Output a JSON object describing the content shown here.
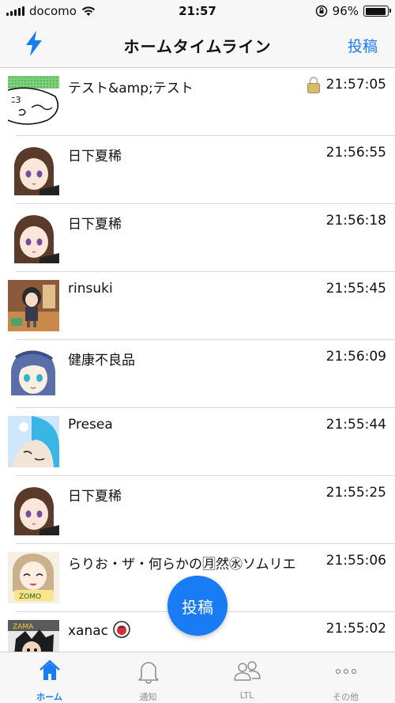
{
  "status_bar": {
    "carrier": "docomo",
    "time": "21:57",
    "battery": "96%",
    "battery_level": 0.96
  },
  "nav": {
    "title": "ホームタイムライン",
    "post_button": "投稿",
    "left_icon": "lightning-bolt-icon"
  },
  "timeline": [
    {
      "name": "テスト&amp;テスト",
      "time": "21:57:05",
      "locked": true,
      "avatar": "doodle-face"
    },
    {
      "name": "日下夏稀",
      "time": "21:56:55",
      "avatar": "anime-girl-brown-hair"
    },
    {
      "name": "日下夏稀",
      "time": "21:56:18",
      "avatar": "anime-girl-brown-hair"
    },
    {
      "name": "rinsuki",
      "time": "21:55:45",
      "avatar": "chibi-character"
    },
    {
      "name": "健康不良品",
      "time": "21:56:09",
      "avatar": "anime-girl-blue-hair"
    },
    {
      "name": "Presea",
      "time": "21:55:44",
      "avatar": "anime-character-cyan"
    },
    {
      "name": "日下夏稀",
      "time": "21:55:25",
      "avatar": "anime-girl-brown-hair"
    },
    {
      "name": "らりお・ザ・何らかの🈷然㊌ソムリエ",
      "time": "21:55:06",
      "avatar": "anime-girl-light-hair"
    },
    {
      "name": "xanac",
      "time": "21:55:02",
      "avatar": "dark-anime-character",
      "badge": "red-circle-badge"
    }
  ],
  "fab": {
    "label": "投稿"
  },
  "tabs": [
    {
      "label": "ホーム",
      "icon": "home-icon",
      "active": true
    },
    {
      "label": "通知",
      "icon": "bell-icon",
      "active": false
    },
    {
      "label": "LTL",
      "icon": "people-icon",
      "active": false
    },
    {
      "label": "その他",
      "icon": "more-icon",
      "active": false
    }
  ],
  "colors": {
    "accent": "#1a7cf5",
    "bar_bg": "#f7f7f7",
    "separator": "#d8d8dc",
    "inactive": "#8e8e93"
  }
}
